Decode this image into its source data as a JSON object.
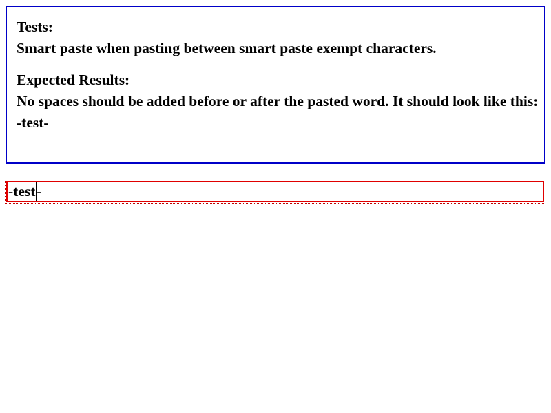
{
  "instructions": {
    "tests_heading": "Tests:",
    "tests_text": "Smart paste when pasting between smart paste exempt characters.",
    "expected_heading": "Expected Results:",
    "expected_text": "No spaces should be added before or after the pasted word. It should look like this:",
    "expected_example": "-test-"
  },
  "editable": {
    "before_caret": "-test",
    "after_caret": "-"
  },
  "colors": {
    "instructions_border": "#0000c8",
    "editable_border": "#e00000"
  }
}
